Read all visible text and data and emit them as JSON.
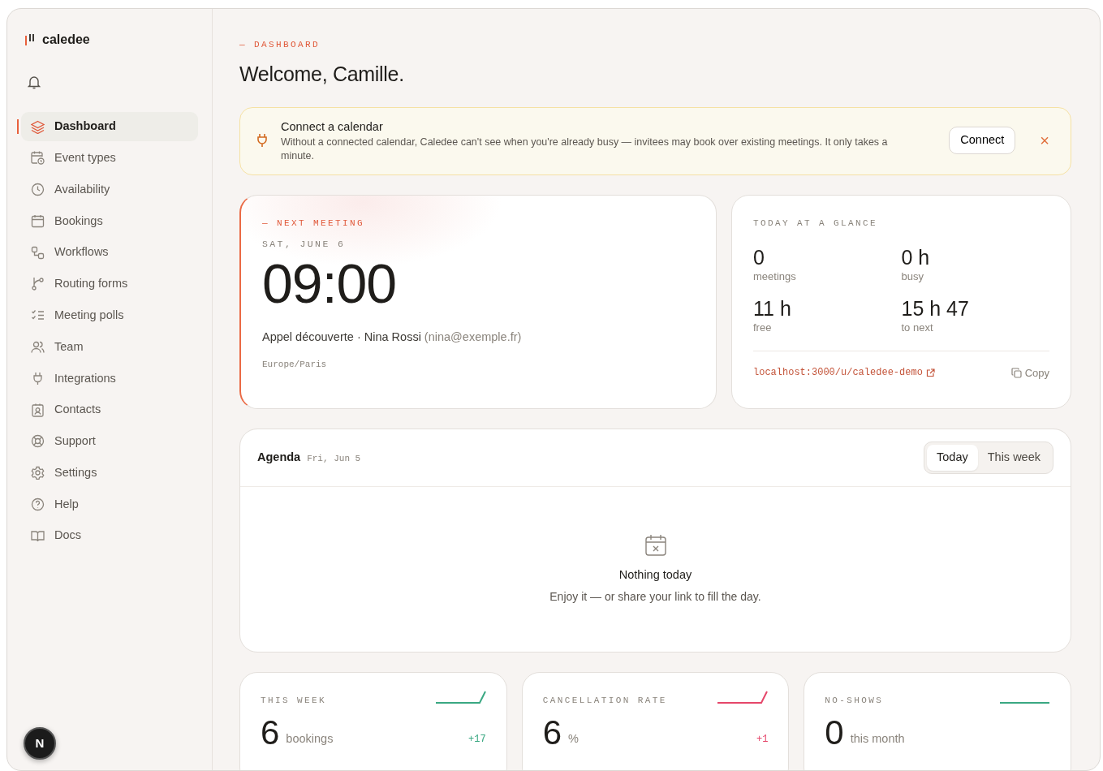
{
  "sidebar": {
    "brand": "caledee",
    "items": [
      {
        "label": "Dashboard",
        "selected": true
      },
      {
        "label": "Event types",
        "selected": false
      },
      {
        "label": "Availability",
        "selected": false
      },
      {
        "label": "Bookings",
        "selected": false
      },
      {
        "label": "Workflows",
        "selected": false
      },
      {
        "label": "Routing forms",
        "selected": false
      },
      {
        "label": "Meeting polls",
        "selected": false
      },
      {
        "label": "Team",
        "selected": false
      },
      {
        "label": "Integrations",
        "selected": false
      },
      {
        "label": "Contacts",
        "selected": false
      },
      {
        "label": "Support",
        "selected": false
      },
      {
        "label": "Settings",
        "selected": false
      },
      {
        "label": "Help",
        "selected": false
      },
      {
        "label": "Docs",
        "selected": false
      }
    ],
    "dev_badge": "N"
  },
  "header": {
    "eyebrow": "— DASHBOARD",
    "title": "Welcome, Camille."
  },
  "banner": {
    "title": "Connect a calendar",
    "text": "Without a connected calendar, Caledee can't see when you're already busy — invitees may book over existing meetings. It only takes a minute.",
    "button": "Connect",
    "close": "×"
  },
  "next_meeting": {
    "eyebrow": "— NEXT MEETING",
    "date": "SAT, JUNE 6",
    "time": "09:00",
    "summary": "Appel découverte · Nina Rossi",
    "email": "(nina@exemple.fr)",
    "timezone": "Europe/Paris"
  },
  "glance": {
    "title": "TODAY AT A GLANCE",
    "stats": [
      {
        "value": "0",
        "label": "meetings"
      },
      {
        "value": "0 h",
        "label": "busy"
      },
      {
        "value": "11 h",
        "label": "free"
      },
      {
        "value": "15 h 47",
        "label": "to next"
      }
    ],
    "link": "localhost:3000/u/caledee-demo",
    "copy": "Copy"
  },
  "agenda": {
    "title": "Agenda",
    "date": "Fri, Jun 5",
    "tabs": [
      {
        "label": "Today",
        "selected": true
      },
      {
        "label": "This week",
        "selected": false
      }
    ],
    "empty_title": "Nothing today",
    "empty_text": "Enjoy it — or share your link to fill the day."
  },
  "stats": [
    {
      "label": "THIS WEEK",
      "value": "6",
      "unit": "bookings",
      "delta": "+17",
      "color": "#3aa882",
      "kind": "rising"
    },
    {
      "label": "CANCELLATION RATE",
      "value": "6",
      "unit": "%",
      "delta": "+1",
      "color": "#e5466a",
      "kind": "rising"
    },
    {
      "label": "NO-SHOWS",
      "value": "0",
      "unit": "this month",
      "color": "#3aa882",
      "kind": "flat"
    }
  ]
}
